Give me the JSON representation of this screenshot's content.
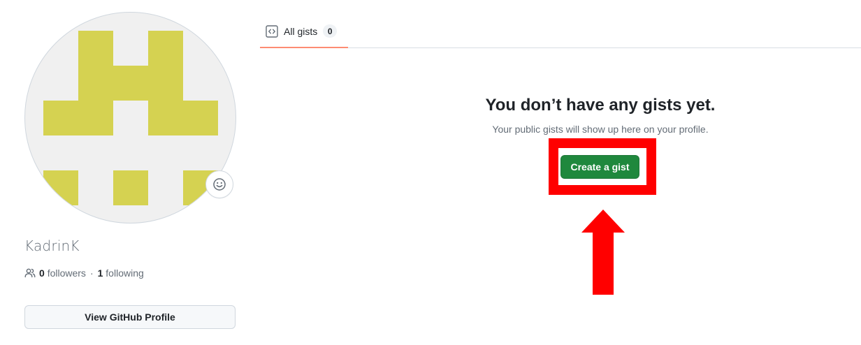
{
  "sidebar": {
    "avatar_color": "#d5d251",
    "status_icon": "smiley-icon",
    "username": "KadrinK",
    "followers_count": "0",
    "followers_label": "followers",
    "separator": "·",
    "following_count": "1",
    "following_label": "following",
    "view_profile_label": "View GitHub Profile"
  },
  "tabs": [
    {
      "label": "All gists",
      "count": "0",
      "icon": "code-square-icon",
      "selected": true
    }
  ],
  "blankslate": {
    "title": "You don’t have any gists yet.",
    "description": "Your public gists will show up here on your profile.",
    "button_label": "Create a gist",
    "button_color": "#1f883d"
  },
  "annotation": {
    "highlight_color": "#ff0000",
    "arrow": "up-arrow"
  }
}
